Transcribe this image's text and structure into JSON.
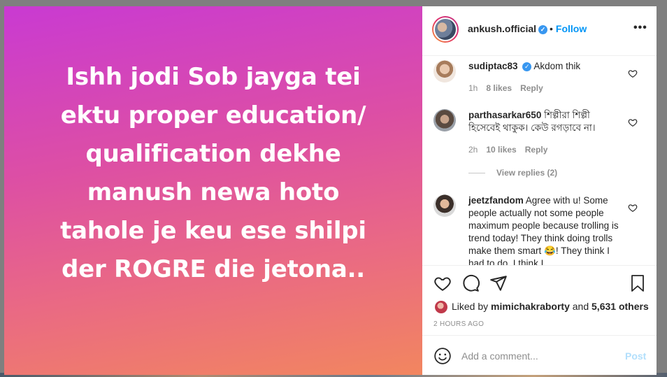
{
  "post": {
    "lines": [
      "Ishh jodi Sob jayga tei",
      "ektu proper education/",
      "qualification dekhe",
      "manush newa hoto",
      "tahole je keu ese shilpi",
      "der ROGRE die jetona.."
    ]
  },
  "header": {
    "username": "ankush.official",
    "separator": "•",
    "follow_label": "Follow",
    "more_label": "•••",
    "verified_mark": "✓"
  },
  "comments": [
    {
      "username": "sudiptac83",
      "verified": true,
      "text": "Akdom thik",
      "time": "1h",
      "likes": "8 likes",
      "reply": "Reply"
    },
    {
      "username": "parthasarkar650",
      "verified": false,
      "text": "শিল্পীরা শিল্পী হিসেবেই থাকুক। কেউ রগড়াবে না।",
      "time": "2h",
      "likes": "10 likes",
      "reply": "Reply"
    },
    {
      "username": "jeetzfandom",
      "verified": false,
      "text": "Agree with u! Some people actually not some people maximum people because trolling is trend today! They think doing trolls make them smart 😂! They think I had to do. I think I ...",
      "time": "",
      "likes": "",
      "reply": ""
    }
  ],
  "view_replies": "View replies (2)",
  "likes": {
    "prefix": "Liked by",
    "user": "mimichakraborty",
    "middle": "and",
    "count": "5,631 others"
  },
  "timestamp": "2 HOURS AGO",
  "add_comment": {
    "placeholder": "Add a comment...",
    "post_label": "Post"
  },
  "colors": {
    "accent": "#0095f6",
    "verified": "#3897f0",
    "gradient_top": "#c93ad2",
    "gradient_bottom": "#f2865f"
  }
}
